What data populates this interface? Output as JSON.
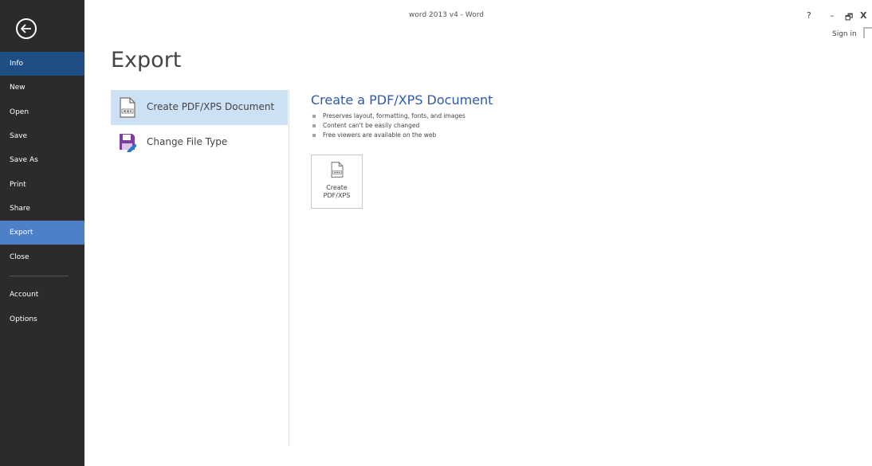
{
  "window": {
    "title": "word 2013 v4 - Word",
    "help_label": "?",
    "minimize_label": "–",
    "restore_label": "🗗",
    "close_label": "X",
    "sign_in_label": "Sign in"
  },
  "sidebar": {
    "back_icon": "back-arrow-icon",
    "items": [
      {
        "label": "Info"
      },
      {
        "label": "New"
      },
      {
        "label": "Open"
      },
      {
        "label": "Save"
      },
      {
        "label": "Save As"
      },
      {
        "label": "Print"
      },
      {
        "label": "Share"
      },
      {
        "label": "Export"
      },
      {
        "label": "Close"
      },
      {
        "label": "Account"
      },
      {
        "label": "Options"
      }
    ],
    "selected": "Export"
  },
  "page": {
    "title": "Export",
    "options": [
      {
        "label": "Create PDF/XPS Document",
        "icon": "pdf-document-icon",
        "selected": true
      },
      {
        "label": "Change File Type",
        "icon": "save-file-type-icon",
        "selected": false
      }
    ]
  },
  "detail": {
    "title": "Create a PDF/XPS Document",
    "bullets": [
      "Preserves layout, formatting, fonts, and images",
      "Content can't be easily changed",
      "Free viewers are available on the web"
    ],
    "button_label": "Create\nPDF/XPS",
    "button_icon": "pdf-document-icon"
  },
  "colors": {
    "sidebar_bg": "#2b2b2b",
    "sidebar_selected": "#4e7fc9",
    "sidebar_info_bg": "#1f4e85",
    "accent_blue": "#2e5aa8",
    "option_selected_bg": "#cde1f5"
  }
}
